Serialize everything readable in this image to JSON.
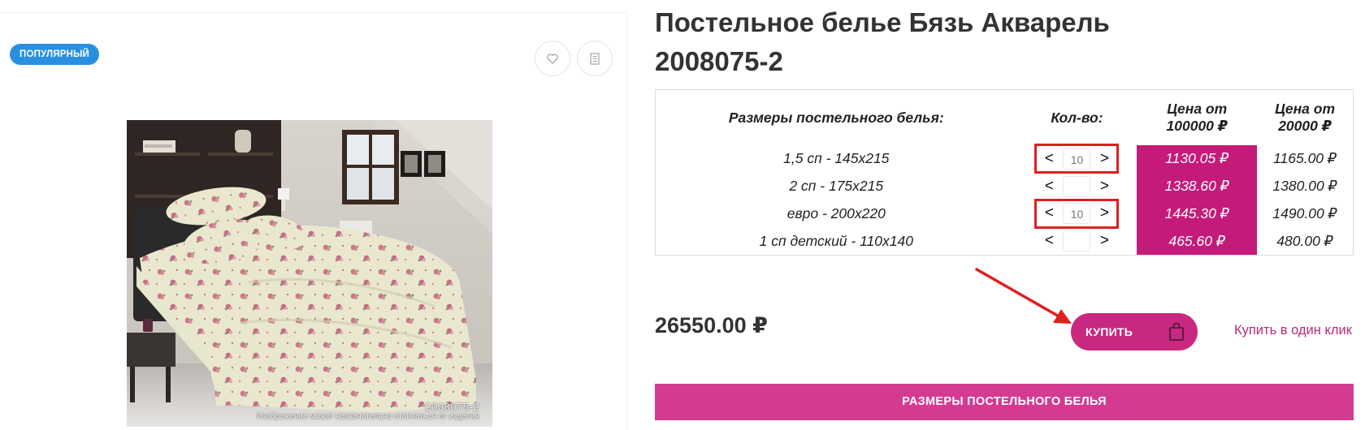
{
  "gallery": {
    "badge": "ПОПУЛЯРНЫЙ",
    "favorite_icon": "heart-icon",
    "compare_icon": "compare-list-icon",
    "photo_code": "2008075-2",
    "photo_note": "Изображение может незначительно отличаться от изделия"
  },
  "product": {
    "title": "Постельное белье Бязь Акварель 2008075-2"
  },
  "table": {
    "headers": {
      "size": "Размеры постельного белья:",
      "qty": "Кол-во:",
      "price1": "Цена от 100000 ₽",
      "price2": "Цена от 20000 ₽"
    },
    "rows": [
      {
        "size": "1,5 сп - 145х215",
        "qty": "10",
        "price1": "1130.05 ₽",
        "price2": "1165.00 ₽"
      },
      {
        "size": "2 сп - 175х215",
        "qty": "",
        "price1": "1338.60 ₽",
        "price2": "1380.00 ₽"
      },
      {
        "size": "евро - 200х220",
        "qty": "10",
        "price1": "1445.30 ₽",
        "price2": "1490.00 ₽"
      },
      {
        "size": "1 сп детский - 110х140",
        "qty": "",
        "price1": "465.60 ₽",
        "price2": "480.00 ₽"
      }
    ],
    "decrease_label": "<",
    "increase_label": ">"
  },
  "purchase": {
    "total": "26550.00 ₽",
    "buy_label": "КУПИТЬ",
    "buy_icon": "shopping-bag-icon",
    "one_click_label": "Купить в один клик",
    "sizes_button_label": "РАЗМЕРЫ ПОСТЕЛЬНОГО БЕЛЬЯ"
  },
  "colors": {
    "accent": "#c8287f",
    "price_highlight": "#c41a7a",
    "badge": "#2a8fe0",
    "annotation": "#e01f1f"
  }
}
